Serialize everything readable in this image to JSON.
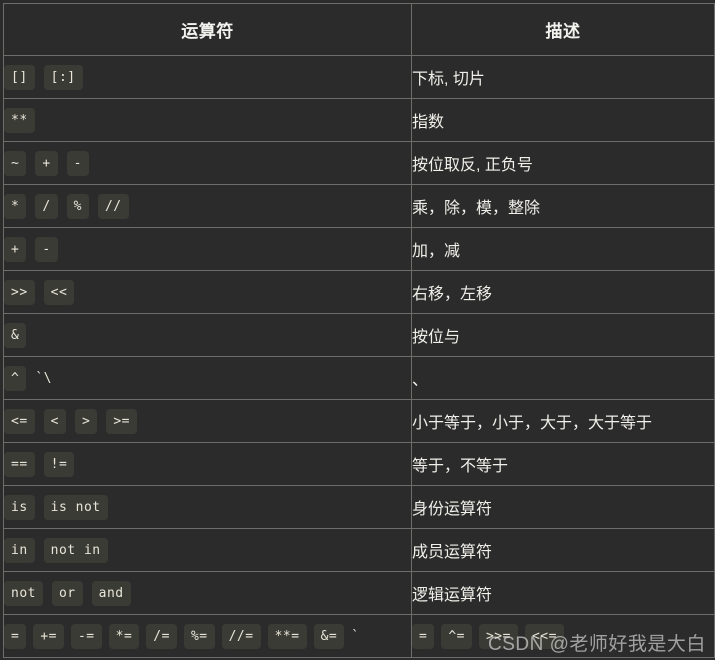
{
  "table": {
    "headers": {
      "operator": "运算符",
      "description": "描述"
    },
    "rows": [
      {
        "chips": [
          "[]",
          "[:]"
        ],
        "plain": [],
        "description": "下标, 切片"
      },
      {
        "chips": [
          "**"
        ],
        "plain": [],
        "description": "指数"
      },
      {
        "chips": [
          "~",
          "+",
          "-"
        ],
        "plain": [],
        "description": "按位取反, 正负号"
      },
      {
        "chips": [
          "*",
          "/",
          "%",
          "//"
        ],
        "plain": [],
        "description": "乘，除，模，整除"
      },
      {
        "chips": [
          "+",
          "-"
        ],
        "plain": [],
        "description": "加，减"
      },
      {
        "chips": [
          ">>",
          "<<"
        ],
        "plain": [],
        "description": "右移，左移"
      },
      {
        "chips": [
          "&"
        ],
        "plain": [],
        "description": "按位与"
      },
      {
        "chips": [
          "^"
        ],
        "plain": [
          "`\\"
        ],
        "description": "、"
      },
      {
        "chips": [
          "<=",
          "<",
          ">",
          ">="
        ],
        "plain": [],
        "description": "小于等于，小于，大于，大于等于"
      },
      {
        "chips": [
          "==",
          "!="
        ],
        "plain": [],
        "description": "等于，不等于"
      },
      {
        "chips": [
          "is",
          "is not"
        ],
        "plain": [],
        "description": "身份运算符"
      },
      {
        "chips": [
          "in",
          "not in"
        ],
        "plain": [],
        "description": "成员运算符"
      },
      {
        "chips": [
          "not",
          "or",
          "and"
        ],
        "plain": [],
        "description": "逻辑运算符"
      }
    ],
    "last_row": {
      "chips": [
        "=",
        "+=",
        "-=",
        "*=",
        "/=",
        "%=",
        "//=",
        "**=",
        "&="
      ],
      "plain": [
        "`"
      ],
      "desc_chips": [
        "=",
        "^=",
        ">>=",
        "<<="
      ]
    }
  },
  "watermark": {
    "text": "CSDN @老师好我是大白"
  }
}
